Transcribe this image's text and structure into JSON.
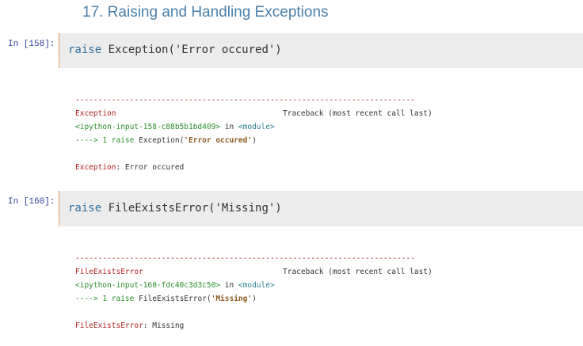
{
  "heading": "17. Raising and Handling Exceptions",
  "cells": [
    {
      "prompt": "In [158]:",
      "code_keyword": "raise",
      "code_rest": " Exception('Error occured')",
      "output": {
        "dashes": "---------------------------------------------------------------------------",
        "exc_name": "Exception",
        "traceback_label": "Traceback (most recent call last)",
        "file_ref": "<ipython-input-158-c88b5b1bd409>",
        "in_word": " in ",
        "module": "<module>",
        "arrow": "----> 1 ",
        "arrow_kw": "raise",
        "arrow_call": " Exception(",
        "arrow_str": "'Error occured'",
        "arrow_close": ")",
        "final_name": "Exception",
        "final_msg": ": Error occured"
      }
    },
    {
      "prompt": "In [160]:",
      "code_keyword": "raise",
      "code_rest": " FileExistsError('Missing')",
      "output": {
        "dashes": "---------------------------------------------------------------------------",
        "exc_name": "FileExistsError",
        "traceback_label": "Traceback (most recent call last)",
        "file_ref": "<ipython-input-160-fdc40c3d3c50>",
        "in_word": " in ",
        "module": "<module>",
        "arrow": "----> 1 ",
        "arrow_kw": "raise",
        "arrow_call": " FileExistsError(",
        "arrow_str": "'Missing'",
        "arrow_close": ")",
        "final_name": "FileExistsError",
        "final_msg": ": Missing"
      }
    }
  ]
}
